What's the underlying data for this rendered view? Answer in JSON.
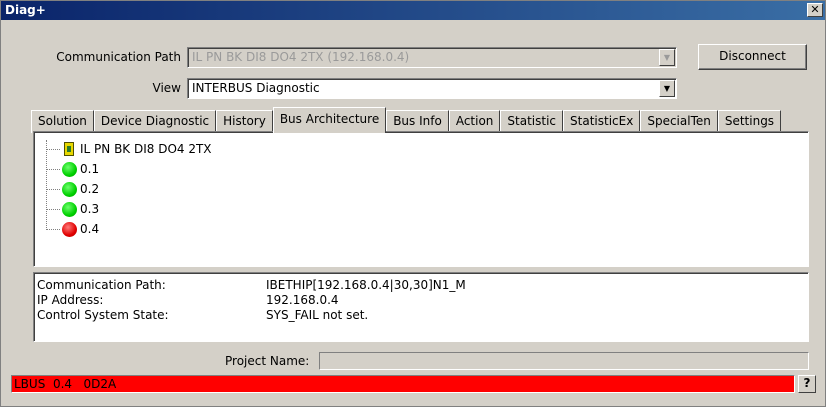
{
  "window": {
    "title": "Diag+",
    "close_glyph": "✕"
  },
  "connection": {
    "path_label": "Communication Path",
    "path_value": "IL PN BK DI8 DO4 2TX (192.168.0.4)",
    "view_label": "View",
    "view_value": "INTERBUS Diagnostic",
    "disconnect_label": "Disconnect"
  },
  "tabs": [
    {
      "label": "Solution"
    },
    {
      "label": "Device Diagnostic"
    },
    {
      "label": "History"
    },
    {
      "label": "Bus Architecture",
      "active": true
    },
    {
      "label": "Bus Info"
    },
    {
      "label": "Action"
    },
    {
      "label": "Statistic"
    },
    {
      "label": "StatisticEx"
    },
    {
      "label": "SpecialTen"
    },
    {
      "label": "Settings"
    }
  ],
  "tree": {
    "root": {
      "label": "IL PN BK DI8 DO4 2TX",
      "icon": "bus-coupler-icon"
    },
    "children": [
      {
        "label": "0.1",
        "status": "green",
        "color": "#00d000"
      },
      {
        "label": "0.2",
        "status": "green",
        "color": "#00d000"
      },
      {
        "label": "0.3",
        "status": "green",
        "color": "#00d000"
      },
      {
        "label": "0.4",
        "status": "red",
        "color": "#e00000"
      }
    ]
  },
  "info": [
    {
      "key": "Communication Path:",
      "value": "IBETHIP[192.168.0.4|30,30]N1_M"
    },
    {
      "key": "IP Address:",
      "value": "192.168.0.4"
    },
    {
      "key": "Control System State:",
      "value": "SYS_FAIL not set."
    }
  ],
  "project": {
    "label": "Project Name:",
    "value": ""
  },
  "status": {
    "text": "LBUS  0.4   0D2A",
    "color": "#ff0000"
  },
  "help": {
    "label": "?"
  }
}
